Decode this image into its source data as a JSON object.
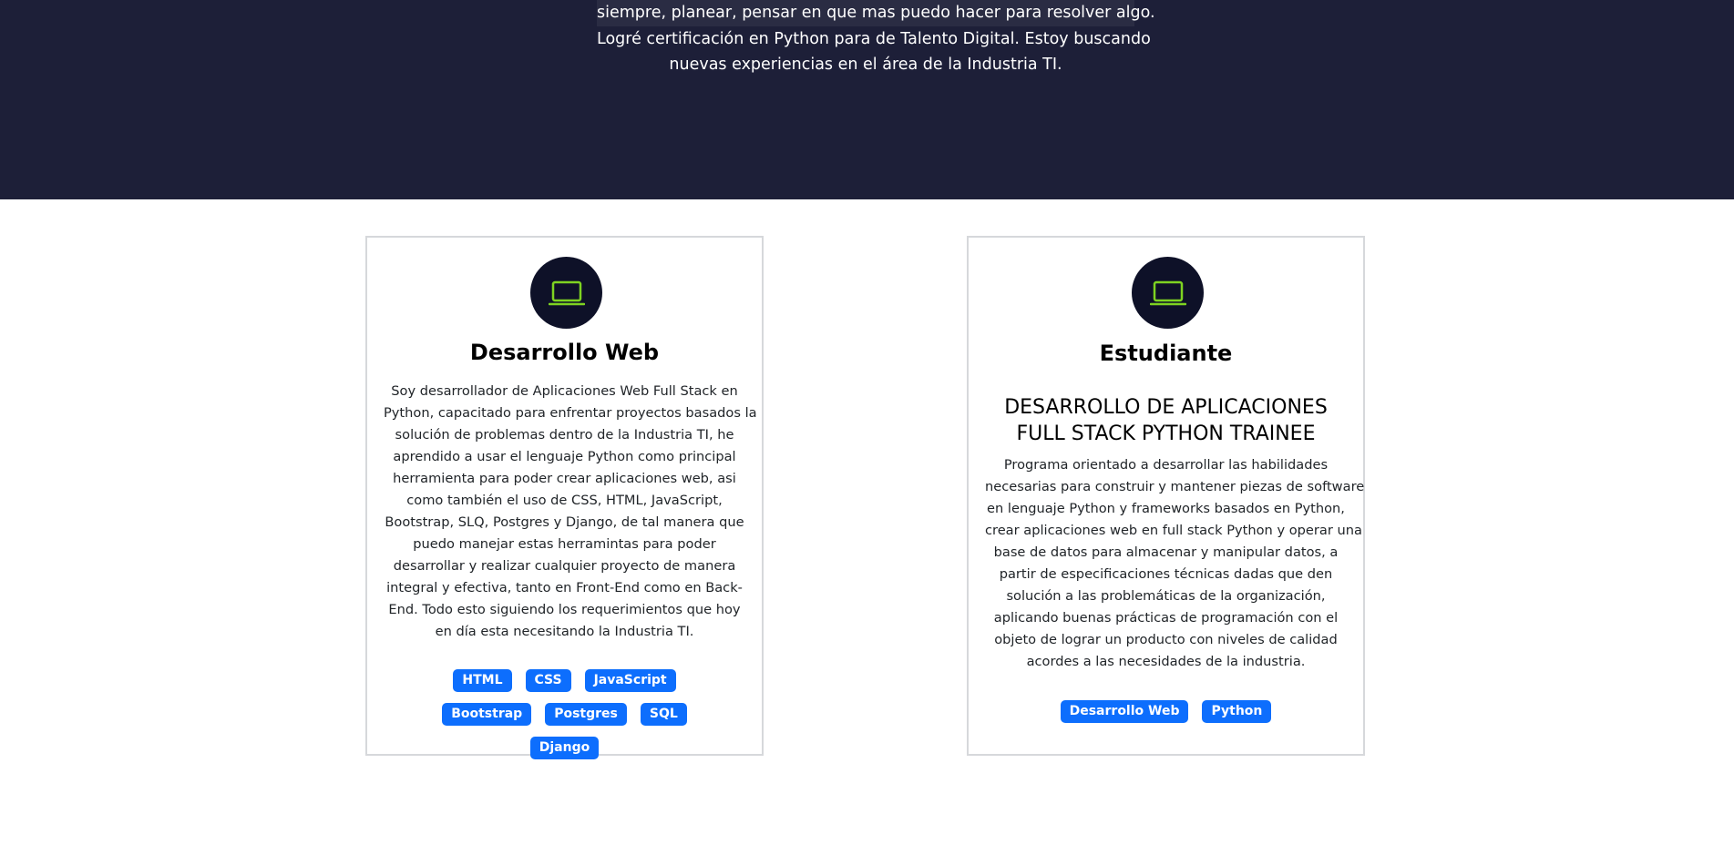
{
  "hero": {
    "lines": [
      "siempre, planear, pensar en que mas puedo hacer para resolver algo.",
      "Logré certificación en Python para de Talento Digital. Estoy buscando",
      "nuevas experiencias en el área de la Industria TI."
    ],
    "bg_color": "#1d1f38"
  },
  "cards": [
    {
      "icon": "laptop-icon",
      "title": "Desarrollo Web",
      "body_lines": [
        "Soy desarrollador de Aplicaciones Web Full Stack en",
        "Python, capacitado para enfrentar proyectos basados la",
        "solución de problemas dentro de la Industria TI, he",
        "aprendido a usar el lenguaje Python como principal",
        "herramienta para poder crear aplicaciones web, asi",
        "como también el uso de CSS, HTML, JavaScript,",
        "Bootstrap, SLQ, Postgres y Django, de tal manera que",
        "puedo manejar estas herramintas para poder",
        "desarrollar y realizar cualquier proyecto de manera",
        "integral y efectiva, tanto en Front-End como en Back-",
        "End. Todo esto siguiendo los requerimientos que hoy",
        "en día esta necesitando la Industria TI."
      ],
      "badges": [
        "HTML",
        "CSS",
        "JavaScript",
        "Bootstrap",
        "Postgres",
        "SQL",
        "Django"
      ]
    },
    {
      "icon": "laptop-icon",
      "title": "Estudiante",
      "subtitle_lines": [
        "DESARROLLO DE APLICACIONES",
        "FULL STACK PYTHON TRAINEE"
      ],
      "body_lines": [
        "Programa orientado a desarrollar las habilidades",
        "necesarias para construir y mantener piezas de software",
        "en lenguaje Python y frameworks basados en Python,",
        "crear aplicaciones web en full stack Python y operar una",
        "base de datos para almacenar y manipular datos, a",
        "partir de especificaciones técnicas dadas que den",
        "solución a las problemáticas de la organización,",
        "aplicando buenas prácticas de programación con el",
        "objeto de lograr un producto con niveles de calidad",
        "acordes a las necesidades de la industria."
      ],
      "badges": [
        "Desarrollo Web",
        "Python"
      ]
    }
  ],
  "colors": {
    "accent_badge": "#0d6efd",
    "icon_circle": "#0e1128",
    "icon_stroke": "#7ed321"
  }
}
